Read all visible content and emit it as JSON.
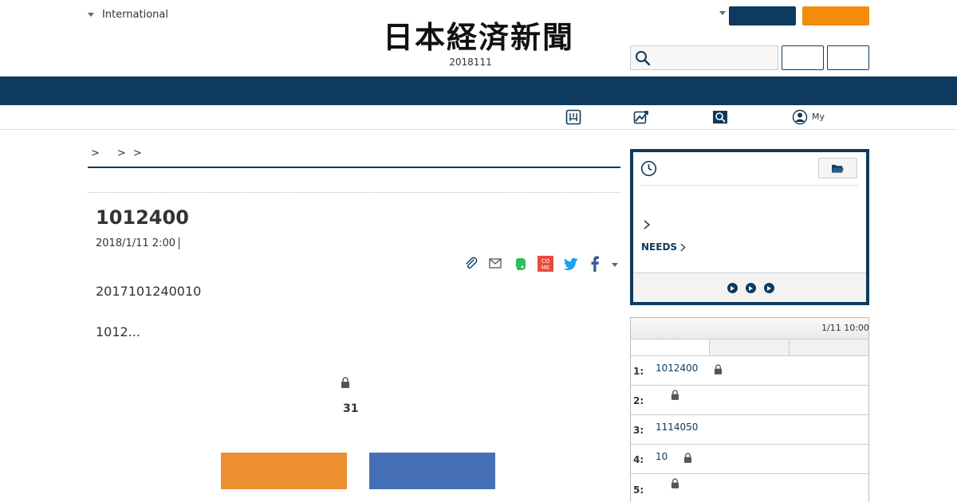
{
  "header": {
    "lang_label": "International",
    "edition_date": "2018111",
    "logo_text": "日本経済新聞"
  },
  "subnav": {
    "my_label": "My"
  },
  "breadcrumb": [
    ">",
    ">",
    ">"
  ],
  "article": {
    "title": "1012400",
    "date": "2018/1/11 2:00",
    "para_1": "2017101240010",
    "para_2": "1012..."
  },
  "paywall": {
    "count": "31"
  },
  "history": {
    "needs_label": "NEEDS"
  },
  "ranking": {
    "updated_time": "1/11 10:00",
    "items": [
      {
        "num": "1:",
        "text": "1012400",
        "locked": true
      },
      {
        "num": "2:",
        "text": "",
        "locked": true
      },
      {
        "num": "3:",
        "text": "1114050",
        "locked": false
      },
      {
        "num": "4:",
        "text": "10",
        "locked": true
      },
      {
        "num": "5:",
        "text": "",
        "locked": true
      }
    ]
  },
  "colors": {
    "navy": "#0d3a5e",
    "orange": "#f38c0a",
    "paywall_orange": "#ed8e31",
    "paywall_blue": "#4570b7"
  },
  "icons": {
    "search": "search-icon",
    "clock": "clock-icon",
    "folder": "folder-icon",
    "lock": "lock-icon"
  }
}
